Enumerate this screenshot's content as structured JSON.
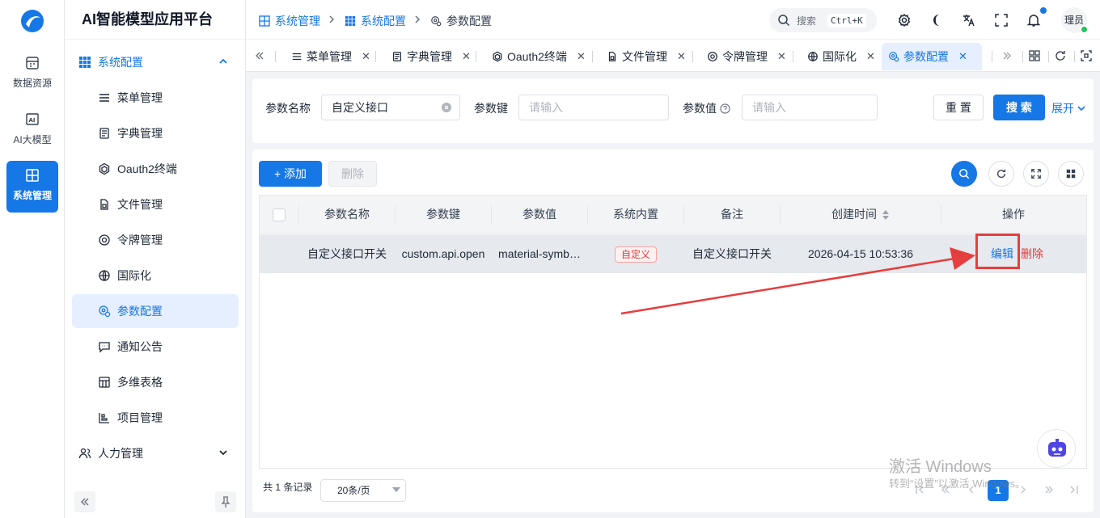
{
  "rail": {
    "items": [
      {
        "label": "数据资源",
        "icon": "database-icon"
      },
      {
        "label": "AI大模型",
        "icon": "ai-icon"
      },
      {
        "label": "系统管理",
        "icon": "system-icon"
      }
    ]
  },
  "sidebar": {
    "brand": "AI智能模型应用平台",
    "group": "系统配置",
    "items": [
      {
        "label": "菜单管理",
        "icon": "menu-list-icon"
      },
      {
        "label": "字典管理",
        "icon": "dictionary-icon"
      },
      {
        "label": "Oauth2终端",
        "icon": "hexagon-icon"
      },
      {
        "label": "文件管理",
        "icon": "file-icon"
      },
      {
        "label": "令牌管理",
        "icon": "token-icon"
      },
      {
        "label": "国际化",
        "icon": "globe-icon"
      },
      {
        "label": "参数配置",
        "icon": "settings-params-icon"
      },
      {
        "label": "通知公告",
        "icon": "message-icon"
      },
      {
        "label": "多维表格",
        "icon": "table-icon"
      },
      {
        "label": "项目管理",
        "icon": "project-icon"
      }
    ],
    "group2": "人力管理"
  },
  "header": {
    "breadcrumb": [
      "系统管理",
      "系统配置",
      "参数配置"
    ],
    "search_label": "搜索",
    "search_shortcut": "Ctrl+K",
    "avatar_text": "理员"
  },
  "tabs": [
    "菜单管理",
    "字典管理",
    "Oauth2终端",
    "文件管理",
    "令牌管理",
    "国际化",
    "参数配置"
  ],
  "filter": {
    "name_label": "参数名称",
    "name_value": "自定义接口",
    "key_label": "参数键",
    "key_placeholder": "请输入",
    "value_label": "参数值",
    "value_placeholder": "请输入",
    "reset": "重 置",
    "search": "搜 索",
    "expand": "展开"
  },
  "toolbar": {
    "add": "+ 添加",
    "delete": "删除"
  },
  "table": {
    "columns": [
      "参数名称",
      "参数键",
      "参数值",
      "系统内置",
      "备注",
      "创建时间",
      "操作"
    ],
    "rows": [
      {
        "name": "自定义接口开关",
        "key": "custom.api.open",
        "value": "material-symb…",
        "builtin": "自定义",
        "remark": "自定义接口开关",
        "created": "2026-04-15 10:53:36",
        "edit": "编辑",
        "delete": "删除"
      }
    ]
  },
  "pager": {
    "total": "共 1 条记录",
    "page_size": "20条/页",
    "current_page": "1"
  },
  "watermark": {
    "line1": "激活 Windows",
    "line2": "转到“设置”以激活 Windows。"
  },
  "colors": {
    "primary": "#1677e6",
    "danger": "#e23b3b",
    "highlight_box": "#e53e3e"
  }
}
